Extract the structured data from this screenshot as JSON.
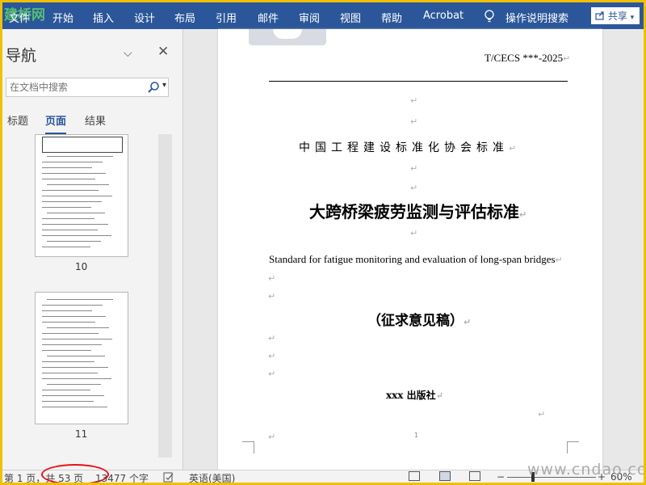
{
  "ribbon": {
    "logo_watermark": "建桥网",
    "tabs": [
      "文件",
      "开始",
      "插入",
      "设计",
      "布局",
      "引用",
      "邮件",
      "审阅",
      "视图",
      "帮助",
      "Acrobat"
    ],
    "tell_me": "操作说明搜索",
    "share_label": "共享"
  },
  "nav": {
    "title": "导航",
    "search_placeholder": "在文档中搜索",
    "tabs": [
      "标题",
      "页面",
      "结果"
    ],
    "active_tab": "页面",
    "thumbnails": [
      {
        "page": "10"
      },
      {
        "page": "11"
      }
    ]
  },
  "document": {
    "standard_code": "T/CECS ***-2025",
    "organization": "中国工程建设标准化协会标准",
    "title_zh": "大跨桥梁疲劳监测与评估标准",
    "title_en": "Standard for fatigue monitoring and evaluation of long-span bridges",
    "draft_label": "（征求意见稿）",
    "publisher": "xxx 出版社",
    "page_number": "1",
    "paragraph_mark": "↵"
  },
  "status": {
    "page_info": "第 1 页，共 53 页",
    "word_count": "13477 个字",
    "language": "英语(美国)",
    "zoom": "60%",
    "minus": "−",
    "plus": "+"
  },
  "watermark": "www.cndao.com",
  "colors": {
    "ribbon": "#2b579a",
    "frame": "#f0c000",
    "highlight_circle": "#e8101a"
  },
  "icons": {
    "tell_me": "lightbulb-icon",
    "search": "magnifier-icon",
    "close": "close-icon",
    "dropdown": "chevron-down-icon",
    "share": "share-icon"
  }
}
